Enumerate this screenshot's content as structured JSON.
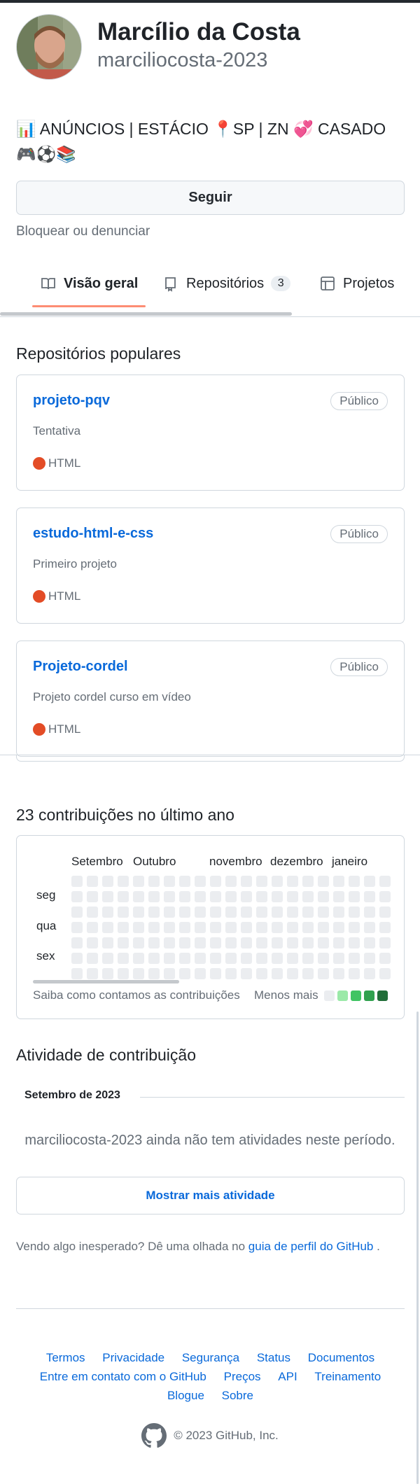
{
  "profile": {
    "name": "Marcílio da Costa",
    "login": "marciliocosta-2023",
    "bio": "📊 ANÚNCIOS | ESTÁCIO 📍SP | ZN 💞 CASADO 🎮⚽📚",
    "follow_label": "Seguir",
    "block_label": "Bloquear ou denunciar"
  },
  "tabs": [
    {
      "label": "Visão geral",
      "icon": "book-icon",
      "active": true
    },
    {
      "label": "Repositórios",
      "icon": "repo-icon",
      "count": "3"
    },
    {
      "label": "Projetos",
      "icon": "table-icon"
    }
  ],
  "popular": {
    "title": "Repositórios populares",
    "repos": [
      {
        "name": "projeto-pqv",
        "visibility": "Público",
        "description": "Tentativa",
        "language": "HTML"
      },
      {
        "name": "estudo-html-e-css",
        "visibility": "Público",
        "description": "Primeiro projeto",
        "language": "HTML"
      },
      {
        "name": "Projeto-cordel",
        "visibility": "Público",
        "description": "Projeto cordel curso em vídeo",
        "language": "HTML"
      }
    ],
    "language_color": "#e34c26"
  },
  "contributions": {
    "title": "23 contribuições no último ano",
    "months": [
      "Setembro",
      "Outubro",
      "novembro",
      "dezembro",
      "janeiro"
    ],
    "days": [
      "seg",
      "qua",
      "sex"
    ],
    "learn_more": "Saiba como contamos as contribuições",
    "less_label": "Menos",
    "more_label": "mais",
    "legend_colors": [
      "#ebedf0",
      "#9be9a8",
      "#40c463",
      "#30a14e",
      "#216e39"
    ],
    "empty_cell_color": "#ebedf0"
  },
  "activity": {
    "title": "Atividade de contribuição",
    "month_heading": "Setembro de 2023",
    "empty_text": "marciliocosta-2023 ainda não tem atividades neste período.",
    "more_button": "Mostrar mais atividade",
    "unexpected_prefix": "Vendo algo inesperado? Dê uma olhada no",
    "unexpected_link": "guia de perfil do GitHub",
    "unexpected_suffix": "."
  },
  "footer": {
    "links": [
      "Termos",
      "Privacidade",
      "Segurança",
      "Status",
      "Documentos",
      "Entre em contato com o GitHub",
      "Preços",
      "API",
      "Treinamento",
      "Blogue",
      "Sobre"
    ],
    "copyright": "© 2023 GitHub, Inc.",
    "logo_icon": "github-mark-icon"
  }
}
